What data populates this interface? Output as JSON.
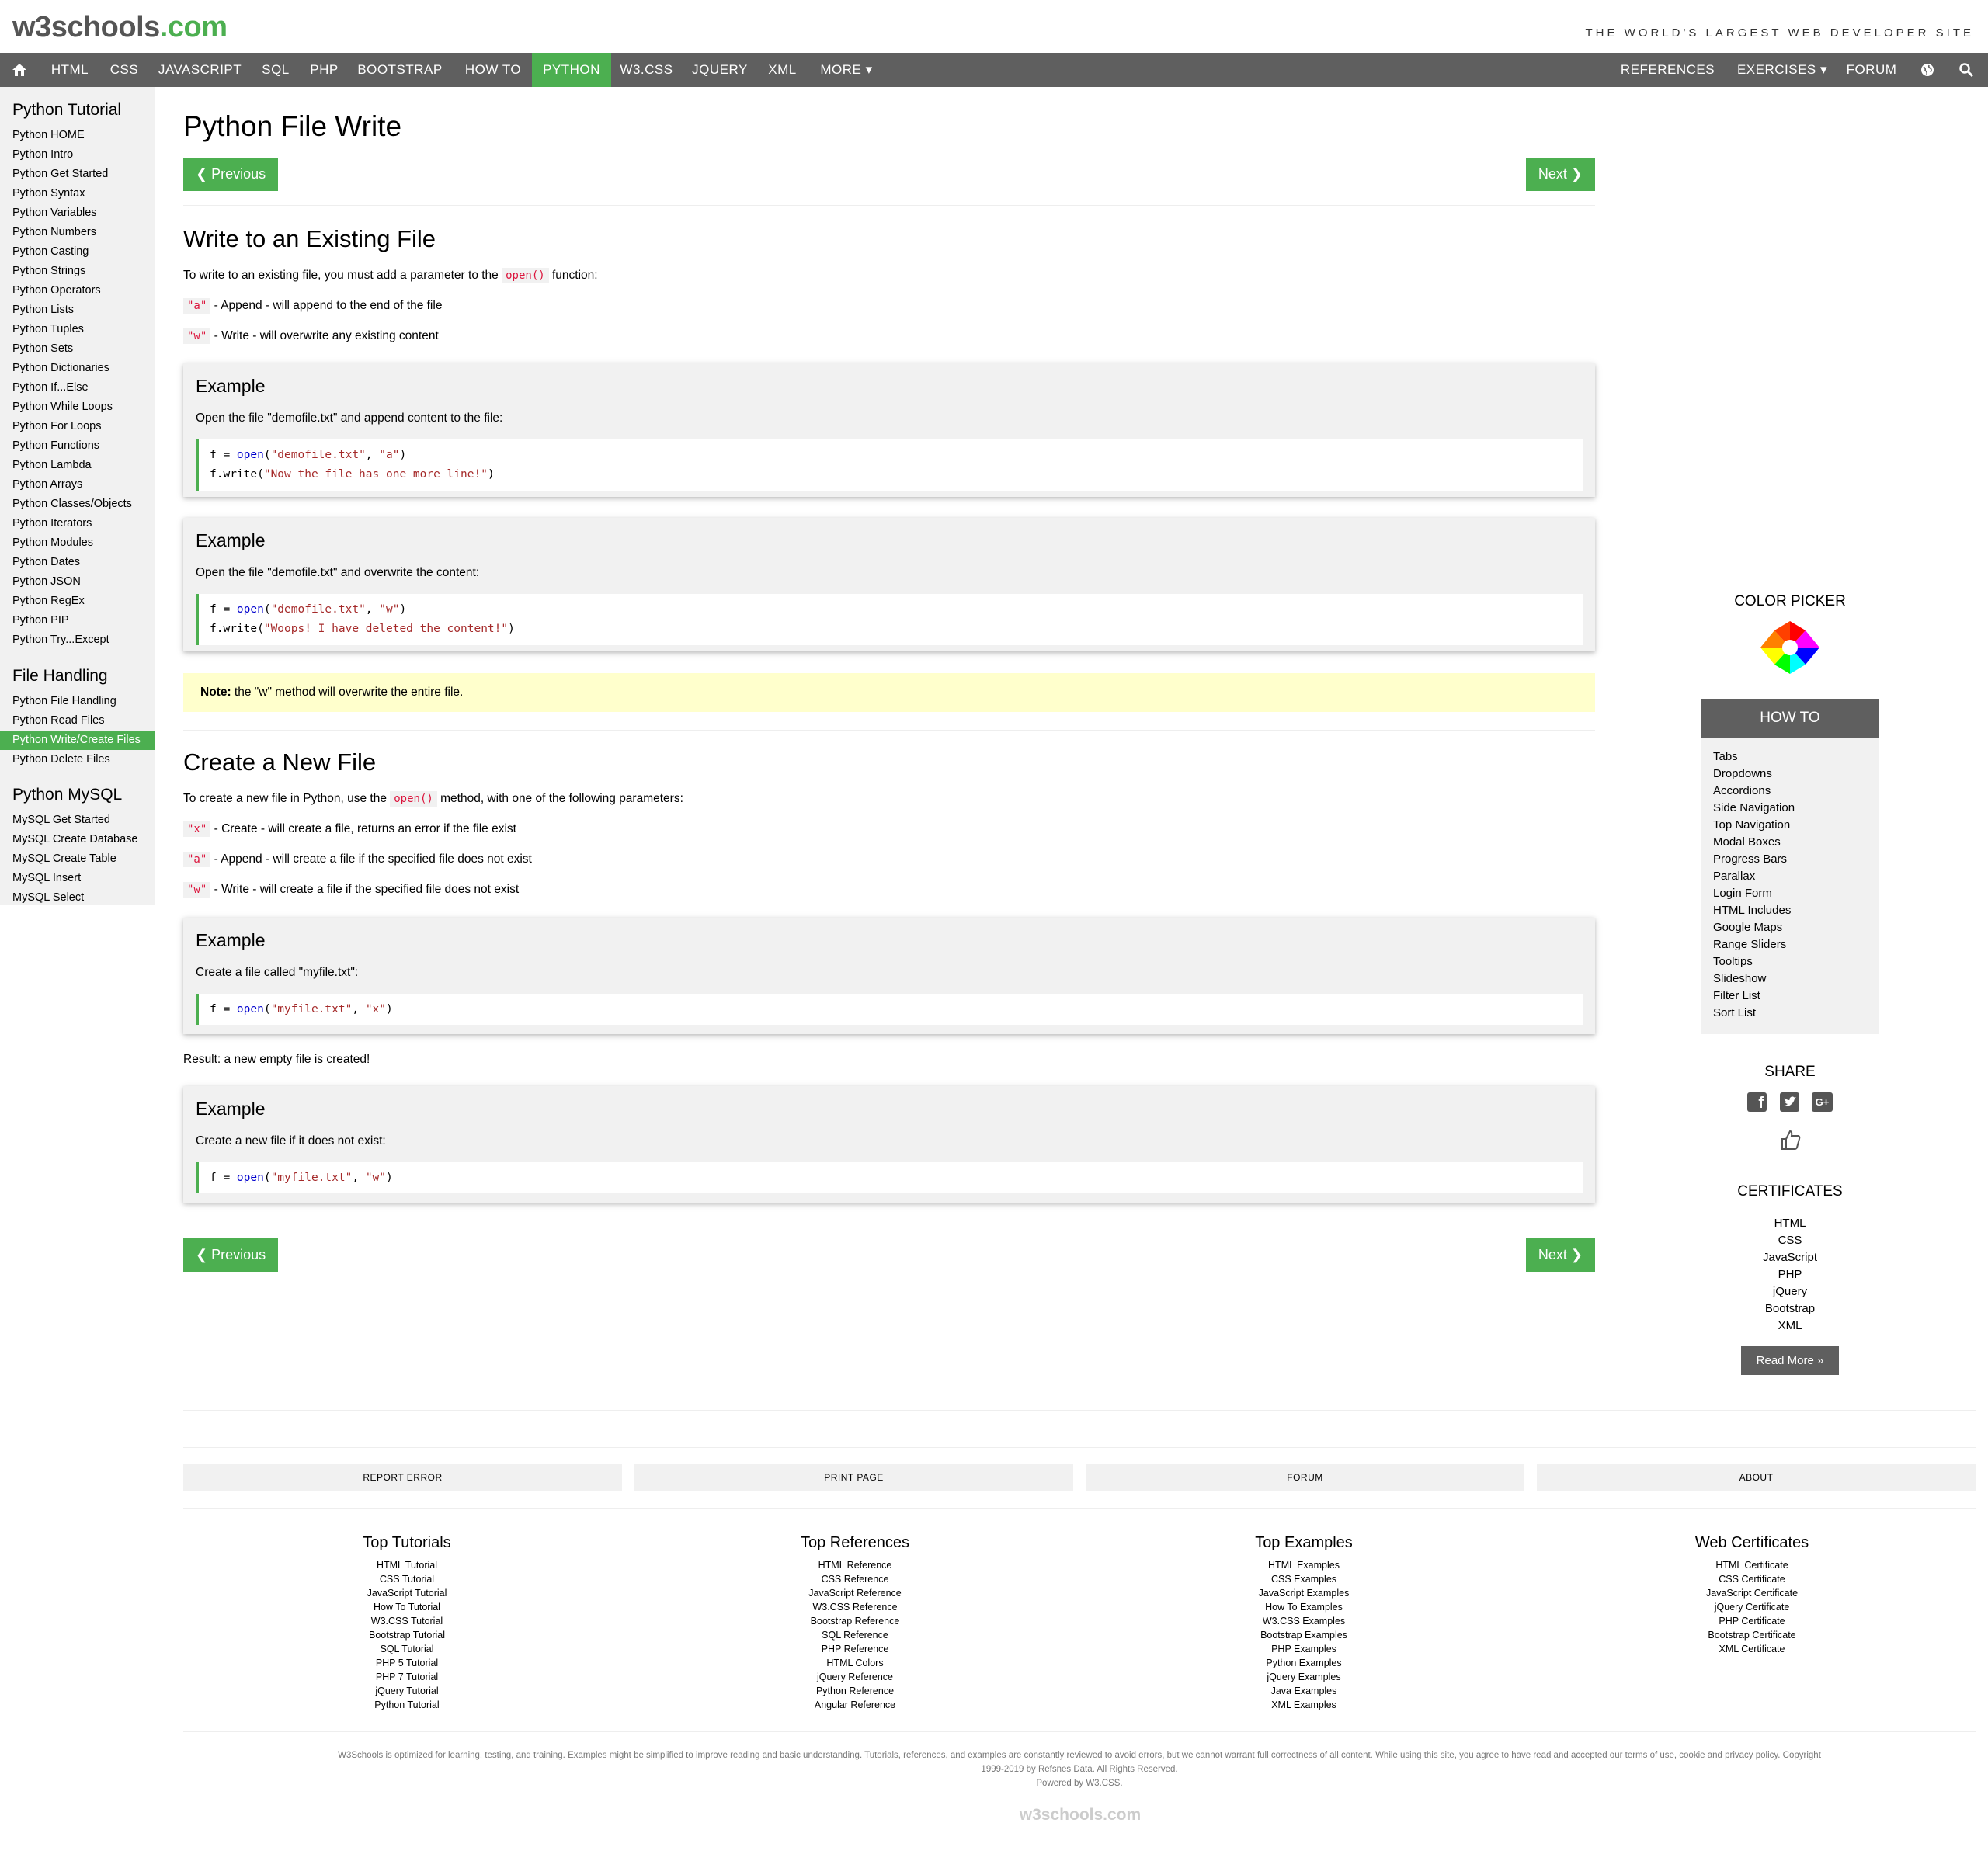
{
  "header": {
    "logo_main": "w3schools",
    "logo_suffix": ".com",
    "slogan": "THE WORLD'S LARGEST WEB DEVELOPER SITE"
  },
  "nav": {
    "items": [
      "HTML",
      "CSS",
      "JAVASCRIPT",
      "SQL",
      "PHP",
      "BOOTSTRAP",
      "HOW TO",
      "PYTHON",
      "W3.CSS",
      "JQUERY",
      "XML",
      "MORE ▾"
    ],
    "right_items": [
      "REFERENCES ▾",
      "EXERCISES ▾",
      "FORUM"
    ],
    "active": "PYTHON"
  },
  "sidebar": {
    "section1_title": "Python Tutorial",
    "section1_items": [
      "Python HOME",
      "Python Intro",
      "Python Get Started",
      "Python Syntax",
      "Python Variables",
      "Python Numbers",
      "Python Casting",
      "Python Strings",
      "Python Operators",
      "Python Lists",
      "Python Tuples",
      "Python Sets",
      "Python Dictionaries",
      "Python If...Else",
      "Python While Loops",
      "Python For Loops",
      "Python Functions",
      "Python Lambda",
      "Python Arrays",
      "Python Classes/Objects",
      "Python Iterators",
      "Python Modules",
      "Python Dates",
      "Python JSON",
      "Python RegEx",
      "Python PIP",
      "Python Try...Except"
    ],
    "section2_title": "File Handling",
    "section2_items": [
      "Python File Handling",
      "Python Read Files",
      "Python Write/Create Files",
      "Python Delete Files"
    ],
    "section2_active": "Python Write/Create Files",
    "section3_title": "Python MySQL",
    "section3_items": [
      "MySQL Get Started",
      "MySQL Create Database",
      "MySQL Create Table",
      "MySQL Insert",
      "MySQL Select"
    ]
  },
  "main": {
    "title": "Python File Write",
    "prev_label": "❮ Previous",
    "next_label": "Next ❯",
    "s1_title": "Write to an Existing File",
    "s1_intro_pre": "To write to an existing file, you must add a parameter to the ",
    "s1_intro_code": "open()",
    "s1_intro_post": " function:",
    "s1_a_code": "\"a\"",
    "s1_a_text": " - Append - will append to the end of the file",
    "s1_w_code": "\"w\"",
    "s1_w_text": " - Write - will overwrite any existing content",
    "example_label": "Example",
    "ex1_desc": "Open the file \"demofile.txt\" and append content to the file:",
    "ex1_line1": {
      "a": "f = ",
      "fn": "open",
      "b": "(",
      "s1": "\"demofile.txt\"",
      "c": ", ",
      "s2": "\"a\"",
      "d": ")"
    },
    "ex1_line2": {
      "a": "f.write(",
      "s": "\"Now the file has one more line!\"",
      "b": ")"
    },
    "ex2_desc": "Open the file \"demofile.txt\" and overwrite the content:",
    "ex2_line1": {
      "a": "f = ",
      "fn": "open",
      "b": "(",
      "s1": "\"demofile.txt\"",
      "c": ", ",
      "s2": "\"w\"",
      "d": ")"
    },
    "ex2_line2": {
      "a": "f.write(",
      "s": "\"Woops! I have deleted the content!\"",
      "b": ")"
    },
    "note_bold": "Note:",
    "note_text": " the \"w\" method will overwrite the entire file.",
    "s2_title": "Create a New File",
    "s2_intro_pre": "To create a new file in Python, use the ",
    "s2_intro_code": "open()",
    "s2_intro_post": " method, with one of the following parameters:",
    "s2_x_code": "\"x\"",
    "s2_x_text": " - Create - will create a file, returns an error if the file exist",
    "s2_a_code": "\"a\"",
    "s2_a_text": " - Append - will create a file if the specified file does not exist",
    "s2_w_code": "\"w\"",
    "s2_w_text": " - Write - will create a file if the specified file does not exist",
    "ex3_desc": "Create a file called \"myfile.txt\":",
    "ex3_line1": {
      "a": "f = ",
      "fn": "open",
      "b": "(",
      "s1": "\"myfile.txt\"",
      "c": ", ",
      "s2": "\"x\"",
      "d": ")"
    },
    "result_text": "Result: a new empty file is created!",
    "ex4_desc": "Create a new file if it does not exist:",
    "ex4_line1": {
      "a": "f = ",
      "fn": "open",
      "b": "(",
      "s1": "\"myfile.txt\"",
      "c": ", ",
      "s2": "\"w\"",
      "d": ")"
    }
  },
  "right_panel": {
    "color_picker_title": "COLOR PICKER",
    "howto_title": "HOW TO",
    "howto_items": [
      "Tabs",
      "Dropdowns",
      "Accordions",
      "Side Navigation",
      "Top Navigation",
      "Modal Boxes",
      "Progress Bars",
      "Parallax",
      "Login Form",
      "HTML Includes",
      "Google Maps",
      "Range Sliders",
      "Tooltips",
      "Slideshow",
      "Filter List",
      "Sort List"
    ],
    "share_title": "SHARE",
    "certificates_title": "CERTIFICATES",
    "certificates_items": [
      "HTML",
      "CSS",
      "JavaScript",
      "PHP",
      "jQuery",
      "Bootstrap",
      "XML"
    ],
    "read_more": "Read More »"
  },
  "footer": {
    "buttons": [
      "REPORT ERROR",
      "PRINT PAGE",
      "FORUM",
      "ABOUT"
    ],
    "columns": [
      {
        "title": "Top Tutorials",
        "links": [
          "HTML Tutorial",
          "CSS Tutorial",
          "JavaScript Tutorial",
          "How To Tutorial",
          "W3.CSS Tutorial",
          "Bootstrap Tutorial",
          "SQL Tutorial",
          "PHP 5 Tutorial",
          "PHP 7 Tutorial",
          "jQuery Tutorial",
          "Python Tutorial"
        ]
      },
      {
        "title": "Top References",
        "links": [
          "HTML Reference",
          "CSS Reference",
          "JavaScript Reference",
          "W3.CSS Reference",
          "Bootstrap Reference",
          "SQL Reference",
          "PHP Reference",
          "HTML Colors",
          "jQuery Reference",
          "Python Reference",
          "Angular Reference"
        ]
      },
      {
        "title": "Top Examples",
        "links": [
          "HTML Examples",
          "CSS Examples",
          "JavaScript Examples",
          "How To Examples",
          "W3.CSS Examples",
          "Bootstrap Examples",
          "PHP Examples",
          "Python Examples",
          "jQuery Examples",
          "Java Examples",
          "XML Examples"
        ]
      },
      {
        "title": "Web Certificates",
        "links": [
          "HTML Certificate",
          "CSS Certificate",
          "JavaScript Certificate",
          "jQuery Certificate",
          "PHP Certificate",
          "Bootstrap Certificate",
          "XML Certificate"
        ]
      }
    ],
    "disclaimer_line1": "W3Schools is optimized for learning, testing, and training. Examples might be simplified to improve reading and basic understanding. Tutorials, references, and examples are constantly reviewed to avoid errors, but we cannot warrant full correctness of all content. While using this site, you agree to have read and accepted our terms of use, cookie and privacy policy. Copyright",
    "disclaimer_line2": "1999-2019 by Refsnes Data. All Rights Reserved.",
    "powered": "Powered by W3.CSS.",
    "bottom_logo": "w3schools.com"
  },
  "colors": {
    "accent": "#4CAF50",
    "nav_bg": "#5f5f5f",
    "code_red": "#dc143c",
    "note_bg": "#ffffcc"
  }
}
